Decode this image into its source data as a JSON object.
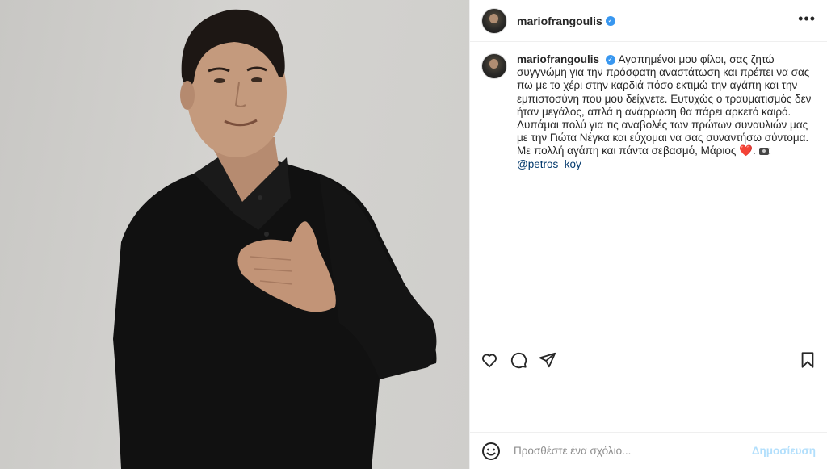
{
  "post": {
    "author": {
      "username": "mariofrangoulis",
      "verified": true
    },
    "caption": {
      "username": "mariofrangoulis",
      "text": "Αγαπημένοι μου φίλοι, σας ζητώ συγγνώμη για την πρόσφατη αναστάτωση και πρέπει να σας πω με το χέρι στην καρδιά πόσο εκτιμώ την αγάπη και την εμπιστοσύνη που μου δείχνετε. Ευτυχώς ο τραυματισμός δεν ήταν μεγάλος, απλά η ανάρρωση θα πάρει αρκετό καιρό. Λυπάμαι πολύ για τις αναβολές των πρώτων συναυλιών μας με την Γιώτα Νέγκα και εύχομαι να σας συναντήσω σύντομα. Με πολλή αγάπη και πάντα σεβασμό, Μάριος",
      "heart": "❤️",
      "separator": ".",
      "mention": "@petros_koy"
    },
    "actions": {
      "like_icon": "heart-outline-icon",
      "comment_icon": "speech-bubble-icon",
      "share_icon": "paper-plane-icon",
      "save_icon": "bookmark-icon"
    },
    "comment_box": {
      "placeholder": "Προσθέστε ένα σχόλιο...",
      "publish_label": "Δημοσίευση",
      "emoji_icon": "smiley-icon"
    },
    "header": {
      "more_label": "•••"
    }
  },
  "colors": {
    "verified_badge": "#3897f0",
    "mention": "#00376b",
    "publish_disabled": "#b2dffc",
    "text": "#262626",
    "placeholder": "#8e8e8e",
    "border": "#efefef"
  }
}
